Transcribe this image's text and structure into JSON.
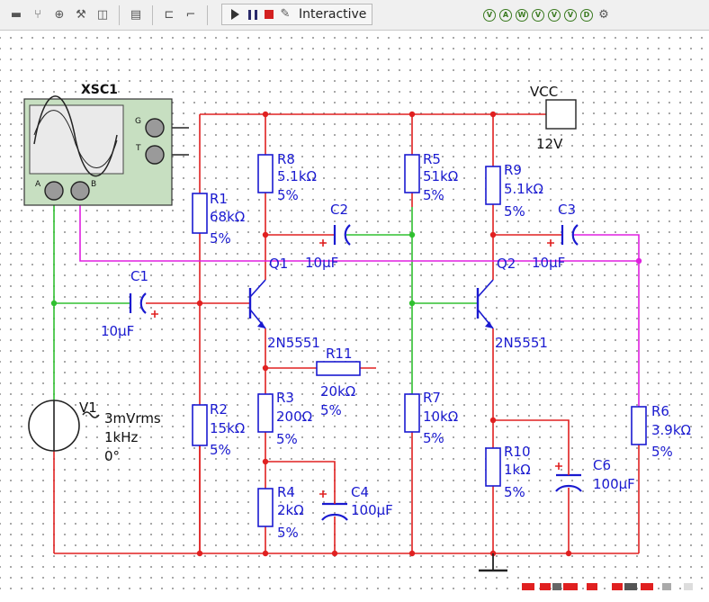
{
  "toolbar": {
    "run_mode_label": "Interactive",
    "colors": {
      "stop": "#d32020",
      "probe": "#3a7a20"
    }
  },
  "instrument": {
    "name": "XSC1",
    "terminals": {
      "g": "G",
      "t": "T",
      "a": "A",
      "b": "B"
    }
  },
  "power": {
    "name": "VCC",
    "value": "12V"
  },
  "source": {
    "name": "V1",
    "amplitude": "3mVrms",
    "frequency": "1kHz",
    "phase": "0°"
  },
  "components": {
    "r1": {
      "name": "R1",
      "value": "68kΩ",
      "tol": "5%"
    },
    "r2": {
      "name": "R2",
      "value": "15kΩ",
      "tol": "5%"
    },
    "r3": {
      "name": "R3",
      "value": "200Ω",
      "tol": "5%"
    },
    "r4": {
      "name": "R4",
      "value": "2kΩ",
      "tol": "5%"
    },
    "r5": {
      "name": "R5",
      "value": "51kΩ",
      "tol": "5%"
    },
    "r6": {
      "name": "R6",
      "value": "3.9kΩ",
      "tol": "5%"
    },
    "r7": {
      "name": "R7",
      "value": "10kΩ",
      "tol": "5%"
    },
    "r8": {
      "name": "R8",
      "value": "5.1kΩ",
      "tol": "5%"
    },
    "r9": {
      "name": "R9",
      "value": "5.1kΩ",
      "tol": "5%"
    },
    "r10": {
      "name": "R10",
      "value": "1kΩ",
      "tol": "5%"
    },
    "r11": {
      "name": "R11",
      "value": "20kΩ",
      "tol": "5%"
    },
    "c1": {
      "name": "C1",
      "value": "10µF"
    },
    "c2": {
      "name": "C2",
      "value": "10µF"
    },
    "c3": {
      "name": "C3",
      "value": "10µF"
    },
    "c4": {
      "name": "C4",
      "value": "100µF"
    },
    "c6": {
      "name": "C6",
      "value": "100µF"
    },
    "q1": {
      "name": "Q1",
      "model": "2N5551"
    },
    "q2": {
      "name": "Q2",
      "model": "2N5551"
    }
  },
  "wire_colors": {
    "supply": "#e02020",
    "input": "#30c030",
    "scope_b": "#e020e0",
    "labels": "#1a1ad0"
  }
}
